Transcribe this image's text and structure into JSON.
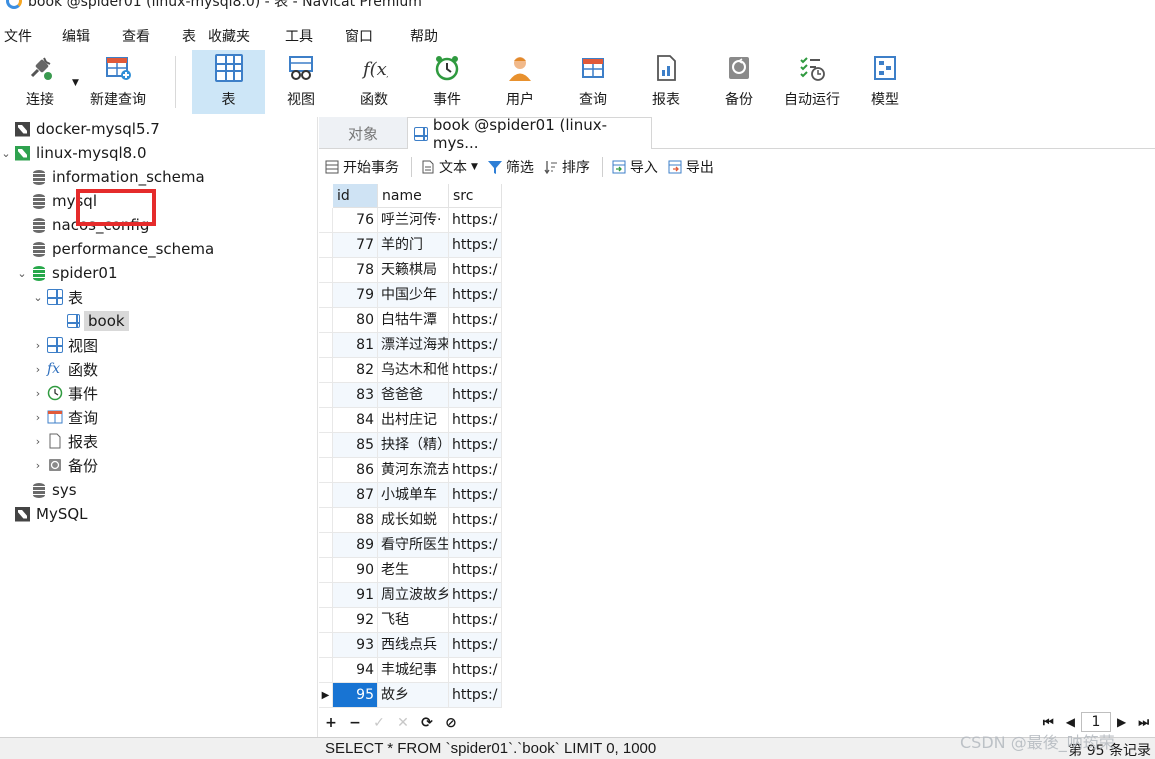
{
  "window": {
    "title": "book @spider01 (linux-mysql8.0) - 表 - Navicat Premium"
  },
  "menu": [
    "文件",
    "编辑",
    "查看",
    "表",
    "收藏夹",
    "工具",
    "窗口",
    "帮助"
  ],
  "toolbar": {
    "connect": "连接",
    "new_query": "新建查询",
    "table": "表",
    "view": "视图",
    "function": "函数",
    "event": "事件",
    "user": "用户",
    "query": "查询",
    "report": "报表",
    "backup": "备份",
    "auto_run": "自动运行",
    "model": "模型"
  },
  "tree": {
    "docker": "docker-mysql5.7",
    "linux": "linux-mysql8.0",
    "information_schema": "information_schema",
    "mysql": "mysql",
    "nacos_config": "nacos_config",
    "performance_schema": "performance_schema",
    "spider01": "spider01",
    "tables": "表",
    "book": "book",
    "views": "视图",
    "functions": "函数",
    "events": "事件",
    "queries": "查询",
    "reports": "报表",
    "backups": "备份",
    "sys": "sys",
    "mysql_conn": "MySQL"
  },
  "tabs": {
    "objects": "对象",
    "book": "book @spider01 (linux-mys..."
  },
  "data_toolbar": {
    "begin_transaction": "开始事务",
    "text": "文本",
    "filter": "筛选",
    "sort": "排序",
    "import": "导入",
    "export": "导出"
  },
  "grid": {
    "columns": [
      "id",
      "name",
      "src"
    ],
    "rows": [
      {
        "id": "76",
        "name": "呼兰河传·",
        "src": "https:/"
      },
      {
        "id": "77",
        "name": "羊的门",
        "src": "https:/"
      },
      {
        "id": "78",
        "name": "天籁棋局",
        "src": "https:/"
      },
      {
        "id": "79",
        "name": "中国少年",
        "src": "https:/"
      },
      {
        "id": "80",
        "name": "白牯牛潭",
        "src": "https:/"
      },
      {
        "id": "81",
        "name": "漂洋过海来",
        "src": "https:/"
      },
      {
        "id": "82",
        "name": "乌达木和他",
        "src": "https:/"
      },
      {
        "id": "83",
        "name": "爸爸爸",
        "src": "https:/"
      },
      {
        "id": "84",
        "name": "出村庄记",
        "src": "https:/"
      },
      {
        "id": "85",
        "name": "抉择（精）",
        "src": "https:/"
      },
      {
        "id": "86",
        "name": "黄河东流去",
        "src": "https:/"
      },
      {
        "id": "87",
        "name": "小城单车",
        "src": "https:/"
      },
      {
        "id": "88",
        "name": "成长如蜕",
        "src": "https:/"
      },
      {
        "id": "89",
        "name": "看守所医生",
        "src": "https:/"
      },
      {
        "id": "90",
        "name": "老生",
        "src": "https:/"
      },
      {
        "id": "91",
        "name": "周立波故乡",
        "src": "https:/"
      },
      {
        "id": "92",
        "name": "飞毡",
        "src": "https:/"
      },
      {
        "id": "93",
        "name": "西线点兵",
        "src": "https:/"
      },
      {
        "id": "94",
        "name": "丰城纪事",
        "src": "https:/"
      },
      {
        "id": "95",
        "name": "故乡",
        "src": "https:/"
      }
    ]
  },
  "navigator": {
    "page": "1",
    "add": "+",
    "remove": "−",
    "apply": "✓",
    "discard": "✕",
    "refresh": "⟳",
    "stop": "⊘"
  },
  "status": {
    "sql": "SELECT * FROM `spider01`.`book` LIMIT 0, 1000",
    "records": "第 95 条记录"
  },
  "watermark": "CSDN @最後_呐筠荣",
  "colors": {
    "accent": "#1874d3",
    "highlight": "#e52b2b",
    "active_tool": "#cde6f7"
  }
}
